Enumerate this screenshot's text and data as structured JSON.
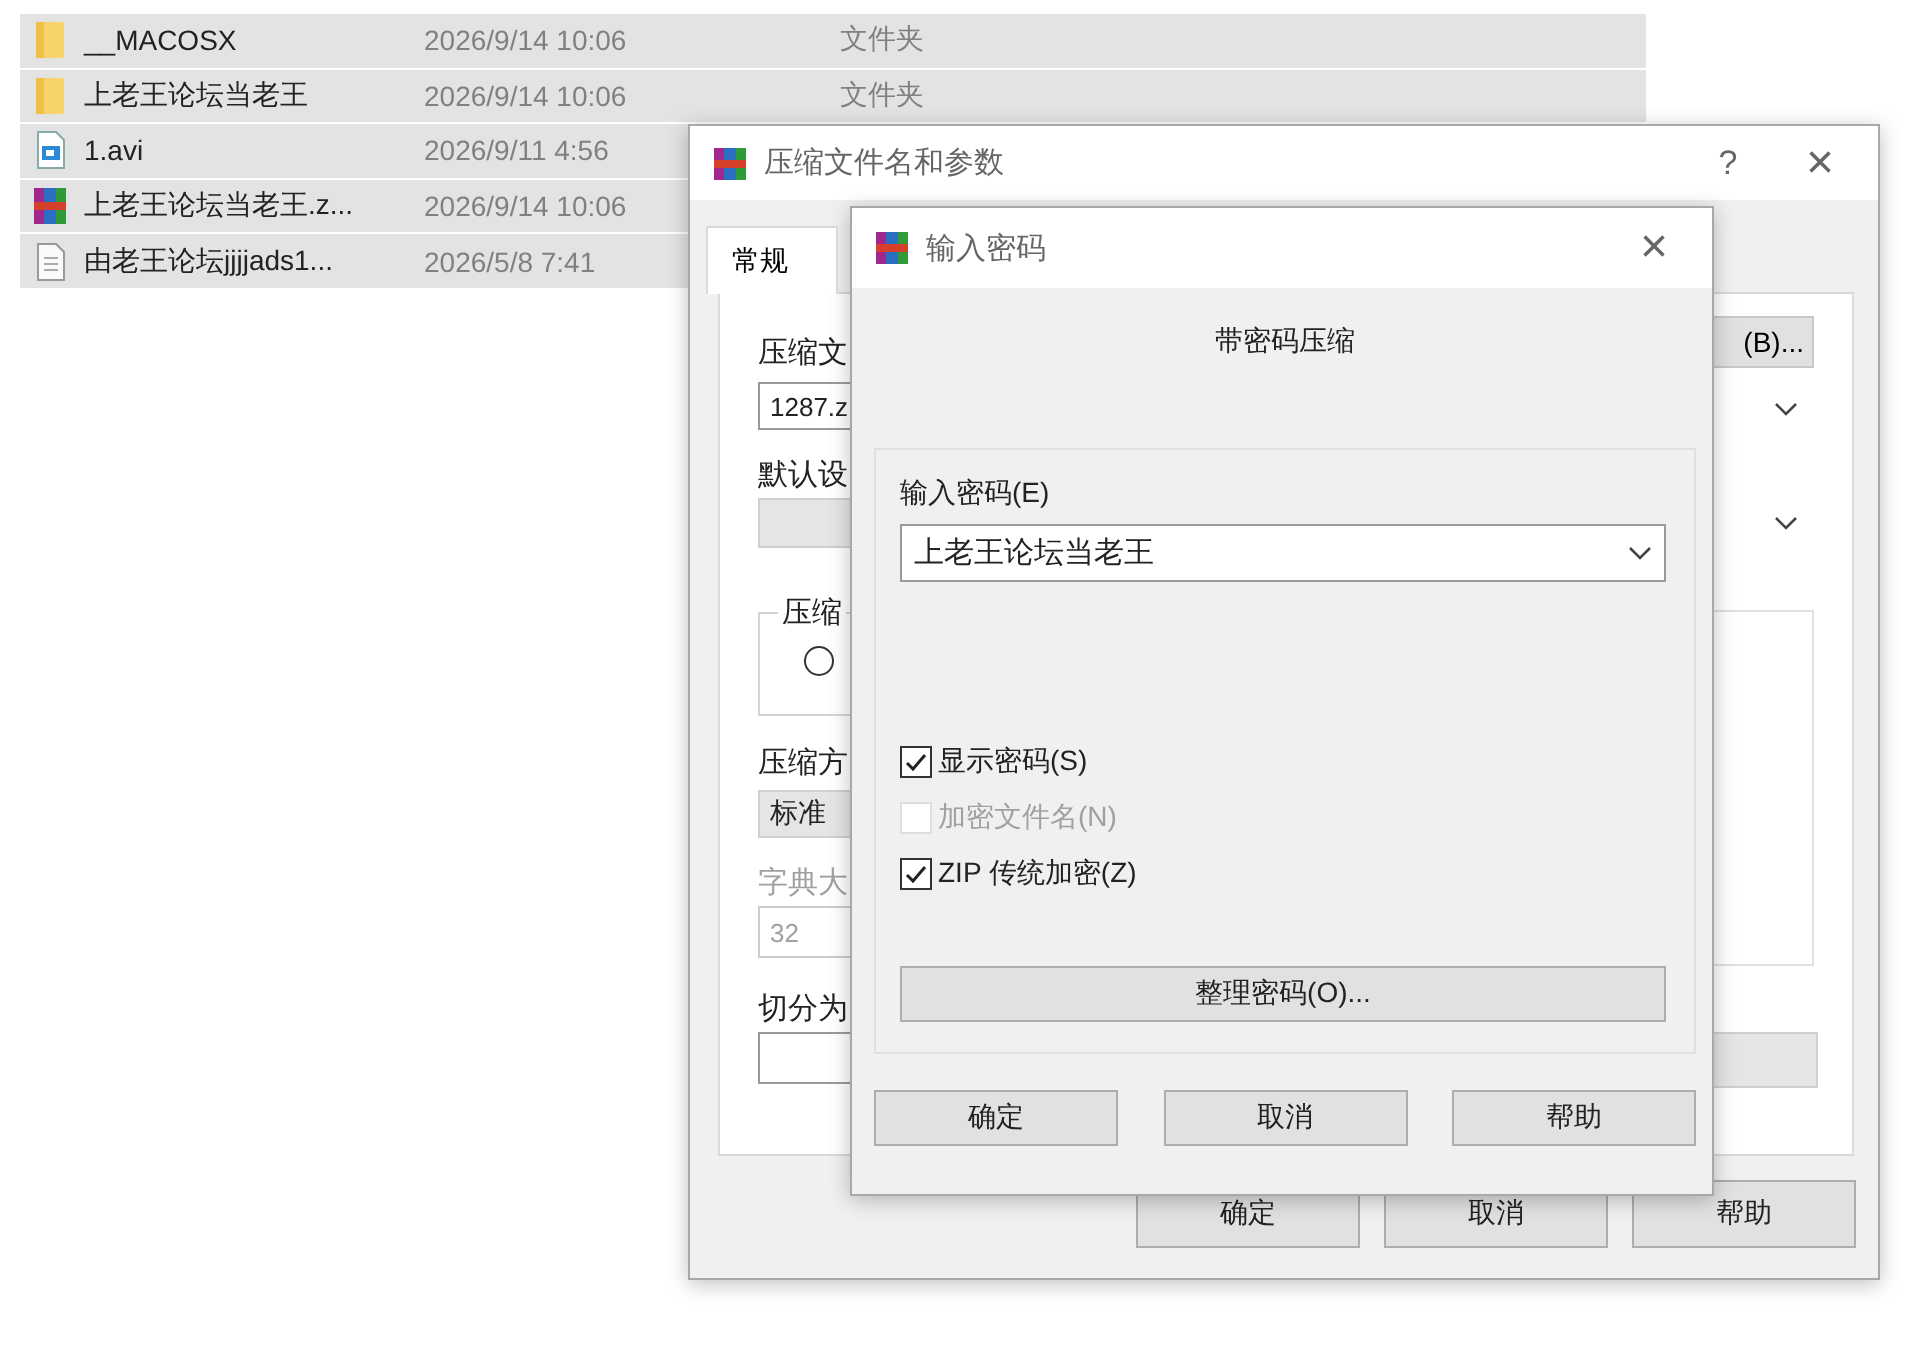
{
  "file_list": [
    {
      "kind": "folder",
      "name": "__MACOSX",
      "modified": "2026/9/14 10:06",
      "type": "文件夹",
      "selected": true
    },
    {
      "kind": "folder",
      "name": "上老王论坛当老王",
      "modified": "2026/9/14 10:06",
      "type": "文件夹",
      "selected": true
    },
    {
      "kind": "video",
      "name": "1.avi",
      "modified": "2026/9/11 4:56",
      "selected": true
    },
    {
      "kind": "archive",
      "name": "上老王论坛当老王.z...",
      "modified": "2026/9/14 10:06",
      "selected": true
    },
    {
      "kind": "text",
      "name": "由老王论坛jjjjads1...",
      "modified": "2026/5/8 7:41",
      "selected": true
    }
  ],
  "archive_dialog": {
    "title": "压缩文件名和参数",
    "help_button": "?",
    "close_button": "×",
    "tabs": [
      {
        "label": "常规",
        "selected": true
      }
    ],
    "archive_name_label": "压缩文",
    "browse_button": "(B)...",
    "archive_name_value": "1287.z",
    "profile_label": "默认设",
    "group_label": "压缩",
    "radio": {
      "selected": false
    },
    "method_label": "压缩方",
    "method_value": "标准",
    "dictionary_label": "字典大",
    "dictionary_value": "32",
    "dictionary_disabled": true,
    "split_label": "切分为",
    "buttons": [
      "确定",
      "取消",
      "帮助"
    ]
  },
  "password_dialog": {
    "title": "输入密码",
    "close_button": "×",
    "heading": "带密码压缩",
    "password_label": "输入密码(E)",
    "password_value": "上老王论坛当老王",
    "options": [
      {
        "label": "显示密码(S)",
        "checked": true,
        "disabled": false
      },
      {
        "label": "加密文件名(N)",
        "checked": false,
        "disabled": true
      },
      {
        "label": "ZIP 传统加密(Z)",
        "checked": true,
        "disabled": false
      }
    ],
    "organize_button": "整理密码(O)...",
    "buttons": [
      "确定",
      "取消",
      "帮助"
    ]
  }
}
